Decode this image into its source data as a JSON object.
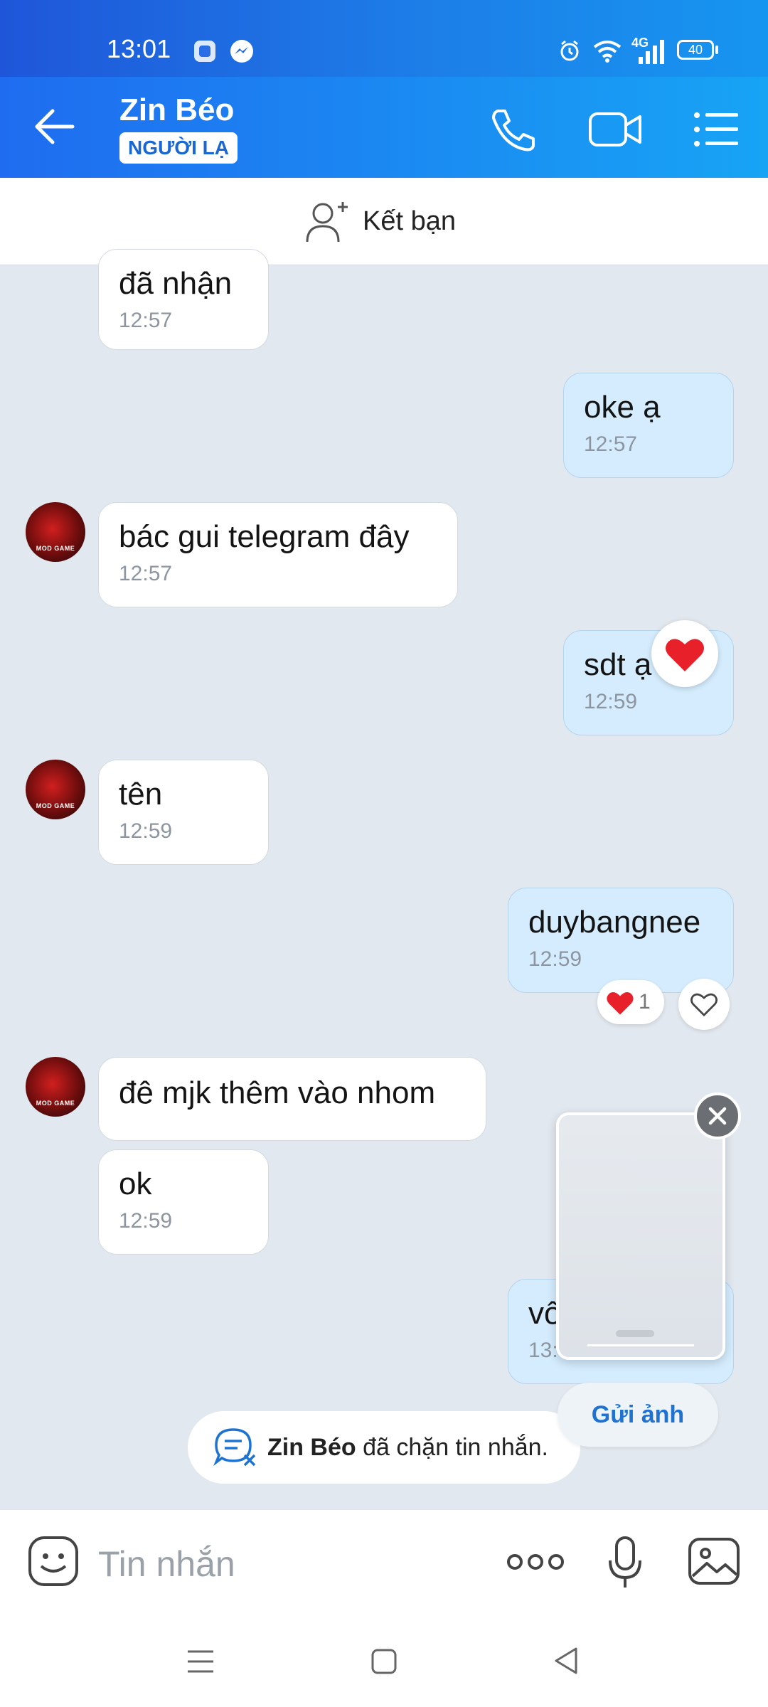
{
  "status_bar": {
    "time": "13:01",
    "network": "4G",
    "battery": "40"
  },
  "header": {
    "contact_name": "Zin Béo",
    "badge": "NGƯỜI LẠ"
  },
  "add_friend": {
    "label": "Kết bạn"
  },
  "messages": [
    {
      "direction": "in",
      "text": "đã nhận",
      "time": "12:57"
    },
    {
      "direction": "out",
      "text": "oke ạ",
      "time": "12:57"
    },
    {
      "direction": "in",
      "text": "bác gui telegram đây",
      "time": "12:57"
    },
    {
      "direction": "out",
      "text": "sdt ạ",
      "time": "12:59",
      "reaction": "heart"
    },
    {
      "direction": "in",
      "text": "tên",
      "time": "12:59"
    },
    {
      "direction": "out",
      "text": "duybangnee",
      "time": "12:59",
      "reaction_count": "1"
    },
    {
      "direction": "in",
      "text": "đê mjk thêm vào nhom",
      "time": ""
    },
    {
      "direction": "in",
      "text": "ok",
      "time": "12:59"
    },
    {
      "direction": "out",
      "text": "vô",
      "time": "13:01"
    }
  ],
  "avatar_text": "MOD GAME",
  "notice": {
    "name": "Zin Béo",
    "text": " đã chặn tin nhắn."
  },
  "preview": {
    "send_label": "Gửi ảnh"
  },
  "input": {
    "placeholder": "Tin nhắn"
  },
  "colors": {
    "header": "#1a8ef2",
    "accent": "#1e73d2",
    "out_bubble": "#d4ecfd",
    "heart": "#e8202a"
  }
}
